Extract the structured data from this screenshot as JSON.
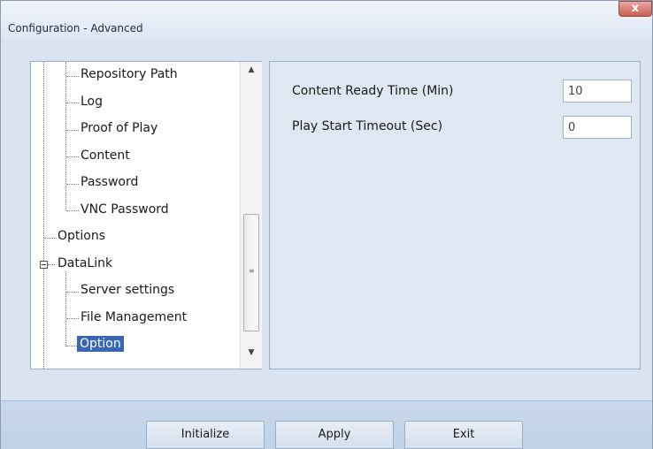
{
  "window": {
    "title": "Configuration - Advanced",
    "close_glyph": "x"
  },
  "tree": {
    "items": [
      {
        "label": "Repository Path"
      },
      {
        "label": "Log"
      },
      {
        "label": "Proof of Play"
      },
      {
        "label": "Content"
      },
      {
        "label": "Password"
      },
      {
        "label": "VNC Password"
      },
      {
        "label": "Options"
      },
      {
        "label": "DataLink",
        "expanded": true
      },
      {
        "label": "Server settings"
      },
      {
        "label": "File Management"
      },
      {
        "label": "Option",
        "selected": true
      }
    ],
    "scroll_up_glyph": "▲",
    "scroll_down_glyph": "▼",
    "grip_glyph": "≡"
  },
  "settings": {
    "content_ready_label": "Content Ready Time (Min)",
    "content_ready_value": "10",
    "play_start_label": "Play Start Timeout (Sec)",
    "play_start_value": "0"
  },
  "buttons": {
    "initialize": "Initialize",
    "apply": "Apply",
    "exit": "Exit"
  },
  "colors": {
    "selection": "#3967b6",
    "background": "#dae4f0"
  }
}
